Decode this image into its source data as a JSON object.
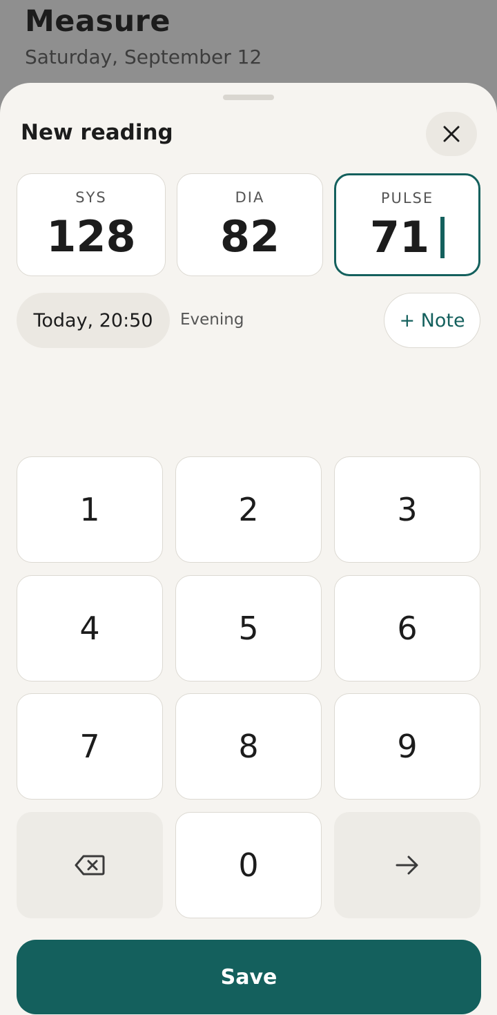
{
  "background": {
    "title": "Measure",
    "subtitle": "Saturday, September 12"
  },
  "sheet": {
    "title": "New reading",
    "close_icon": "close-icon"
  },
  "readings": [
    {
      "label": "SYS",
      "value": "128",
      "active": false
    },
    {
      "label": "DIA",
      "value": "82",
      "active": false
    },
    {
      "label": "PULSE",
      "value": "71",
      "active": true
    }
  ],
  "meta": {
    "time": "Today, 20:50",
    "period": "Evening",
    "note_button": "+ Note"
  },
  "keypad": {
    "keys": [
      "1",
      "2",
      "3",
      "4",
      "5",
      "6",
      "7",
      "8",
      "9",
      "0"
    ],
    "backspace_icon": "backspace-icon",
    "next_icon": "arrow-right-icon"
  },
  "save_label": "Save",
  "colors": {
    "accent": "#14605d",
    "sheet_bg": "#f6f4f0",
    "overlay": "#8f8f8f"
  }
}
